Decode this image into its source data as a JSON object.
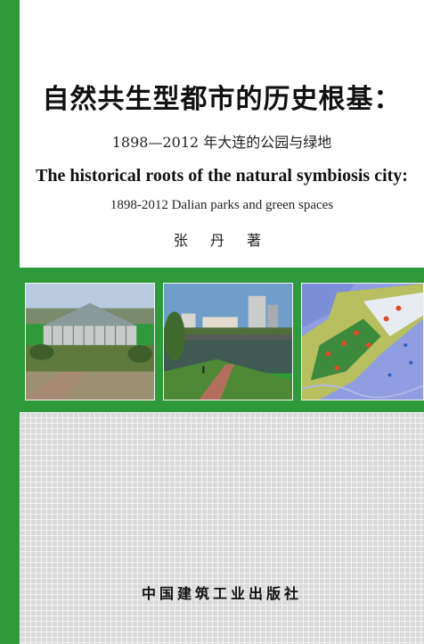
{
  "cover": {
    "title_cn": "自然共生型都市的历史根基：",
    "subtitle_cn": "1898—2012 年大连的公园与绿地",
    "title_en": "The historical roots of the natural symbiosis city:",
    "subtitle_en": "1898-2012 Dalian parks and green spaces",
    "author": "张 丹 著",
    "publisher": "中国建筑工业出版社"
  },
  "colors": {
    "brand_green": "#2e9a3a",
    "grid_gray": "#d9d9d9"
  }
}
